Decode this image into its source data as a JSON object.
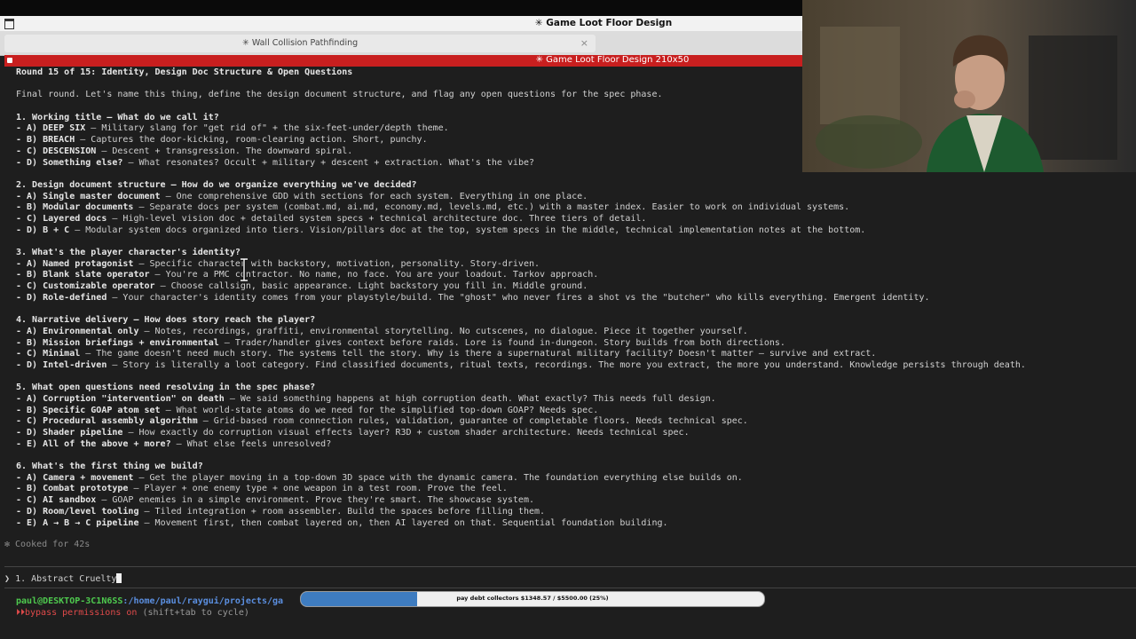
{
  "window": {
    "title": "✳ Game Loot Floor Design"
  },
  "tabs": [
    {
      "label": "✳ Wall Collision Pathfinding",
      "close": "×"
    }
  ],
  "active_terminal": {
    "title": "✳ Game Loot Floor Design 210x50"
  },
  "content": {
    "round": "Round 15 of 15: Identity, Design Doc Structure & Open Questions",
    "intro": "Final round. Let's name this thing, define the design document structure, and flag any open questions for the spec phase.",
    "q1": {
      "heading": "1. Working title — What do we call it?",
      "a_key": "- A) DEEP SIX",
      "a_text": " — Military slang for \"get rid of\" + the six-feet-under/depth theme.",
      "b_key": "- B) BREACH",
      "b_text": " — Captures the door-kicking, room-clearing action. Short, punchy.",
      "c_key": "- C) DESCENSION",
      "c_text": " — Descent + transgression. The downward spiral.",
      "d_key": "- D) Something else?",
      "d_text": " — What resonates? Occult + military + descent + extraction. What's the vibe?"
    },
    "q2": {
      "heading": "2. Design document structure — How do we organize everything we've decided?",
      "a_key": "- A) Single master document",
      "a_text": " — One comprehensive GDD with sections for each system. Everything in one place.",
      "b_key": "- B) Modular documents",
      "b_text": " — Separate docs per system (combat.md, ai.md, economy.md, levels.md, etc.) with a master index. Easier to work on individual systems.",
      "c_key": "- C) Layered docs",
      "c_text": " — High-level vision doc + detailed system specs + technical architecture doc. Three tiers of detail.",
      "d_key": "- D) B + C",
      "d_text": " — Modular system docs organized into tiers. Vision/pillars doc at the top, system specs in the middle, technical implementation notes at the bottom."
    },
    "q3": {
      "heading": "3. What's the player character's identity?",
      "a_key": "- A) Named protagonist",
      "a_text": " — Specific character with backstory, motivation, personality. Story-driven.",
      "b_key": "- B) Blank slate operator",
      "b_text": " — You're a PMC contractor. No name, no face. You are your loadout. Tarkov approach.",
      "c_key": "- C) Customizable operator",
      "c_text": " — Choose callsign, basic appearance. Light backstory you fill in. Middle ground.",
      "d_key": "- D) Role-defined",
      "d_text": " — Your character's identity comes from your playstyle/build. The \"ghost\" who never fires a shot vs the \"butcher\" who kills everything. Emergent identity."
    },
    "q4": {
      "heading": "4. Narrative delivery — How does story reach the player?",
      "a_key": "- A) Environmental only",
      "a_text": " — Notes, recordings, graffiti, environmental storytelling. No cutscenes, no dialogue. Piece it together yourself.",
      "b_key": "- B) Mission briefings + environmental",
      "b_text": " — Trader/handler gives context before raids. Lore is found in-dungeon. Story builds from both directions.",
      "c_key": "- C) Minimal",
      "c_text": " — The game doesn't need much story. The systems tell the story. Why is there a supernatural military facility? Doesn't matter — survive and extract.",
      "d_key": "- D) Intel-driven",
      "d_text": " — Story is literally a loot category. Find classified documents, ritual texts, recordings. The more you extract, the more you understand. Knowledge persists through death."
    },
    "q5": {
      "heading": "5. What open questions need resolving in the spec phase?",
      "a_key": "- A) Corruption \"intervention\" on death",
      "a_text": " — We said something happens at high corruption death. What exactly? This needs full design.",
      "b_key": "- B) Specific GOAP atom set",
      "b_text": " — What world-state atoms do we need for the simplified top-down GOAP? Needs spec.",
      "c_key": "- C) Procedural assembly algorithm",
      "c_text": " — Grid-based room connection rules, validation, guarantee of completable floors. Needs technical spec.",
      "d_key": "- D) Shader pipeline",
      "d_text": " — How exactly do corruption visual effects layer? R3D + custom shader architecture. Needs technical spec.",
      "e_key": "- E) All of the above + more?",
      "e_text": " — What else feels unresolved?"
    },
    "q6": {
      "heading": "6. What's the first thing we build?",
      "a_key": "- A) Camera + movement",
      "a_text": " — Get the player moving in a top-down 3D space with the dynamic camera. The foundation everything else builds on.",
      "b_key": "- B) Combat prototype",
      "b_text": " — Player + one enemy type + one weapon in a test room. Prove the feel.",
      "c_key": "- C) AI sandbox",
      "c_text": " — GOAP enemies in a simple environment. Prove they're smart. The showcase system.",
      "d_key": "- D) Room/level tooling",
      "d_text": " — Tiled integration + room assembler. Build the spaces before filling them.",
      "e_key": "- E) A → B → C pipeline",
      "e_text": " — Movement first, then combat layered on, then AI layered on that. Sequential foundation building."
    }
  },
  "cooked": "✻ Cooked for 42s",
  "prompt": {
    "symbol": "❯",
    "input": "1. Abstract Cruelty"
  },
  "status": {
    "user_host": "paul@DESKTOP-3C1N6SS",
    "path": ":/home/paul/raygui/projects/ga",
    "permissions": "bypass permissions on",
    "hint": " (shift+tab to cycle)",
    "mode_glyph": "⏵⏵"
  },
  "overlay_progress": {
    "label": "pay debt collectors $1348.57 / $5500.00 (25%)",
    "fraction": 0.25
  },
  "colors": {
    "accent_red": "#c81f1f",
    "user_green": "#4ec94e",
    "path_blue": "#5b8fe0",
    "progress_blue": "#3e7cc0"
  }
}
